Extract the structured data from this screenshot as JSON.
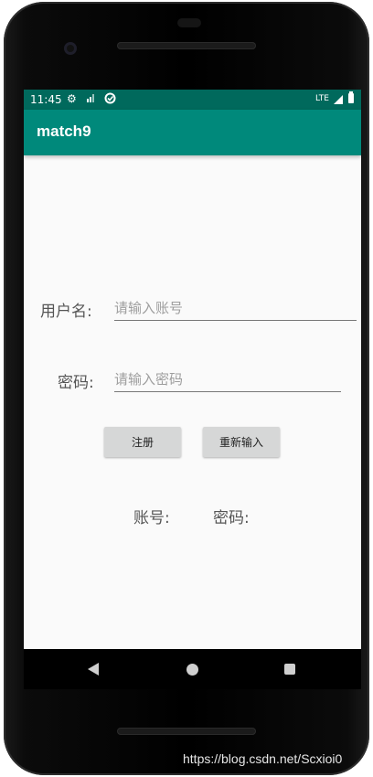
{
  "status_bar": {
    "time": "11:45",
    "network": "LTE"
  },
  "app_bar": {
    "title": "match9"
  },
  "form": {
    "username_label": "用户名:",
    "username_placeholder": "请输入账号",
    "password_label": "密码:",
    "password_placeholder": "请输入密码",
    "register_button": "注册",
    "reset_button": "重新输入"
  },
  "result": {
    "account_label": "账号:",
    "password_label": "密码:"
  },
  "watermark": "https://blog.csdn.net/Scxioi0",
  "icons": {
    "settings": "gear-icon",
    "signal": "signal-icon",
    "sync": "sync-icon"
  },
  "colors": {
    "status_bar": "#00695c",
    "app_bar": "#00897b",
    "background": "#fafafa",
    "button": "#d6d7d7"
  }
}
